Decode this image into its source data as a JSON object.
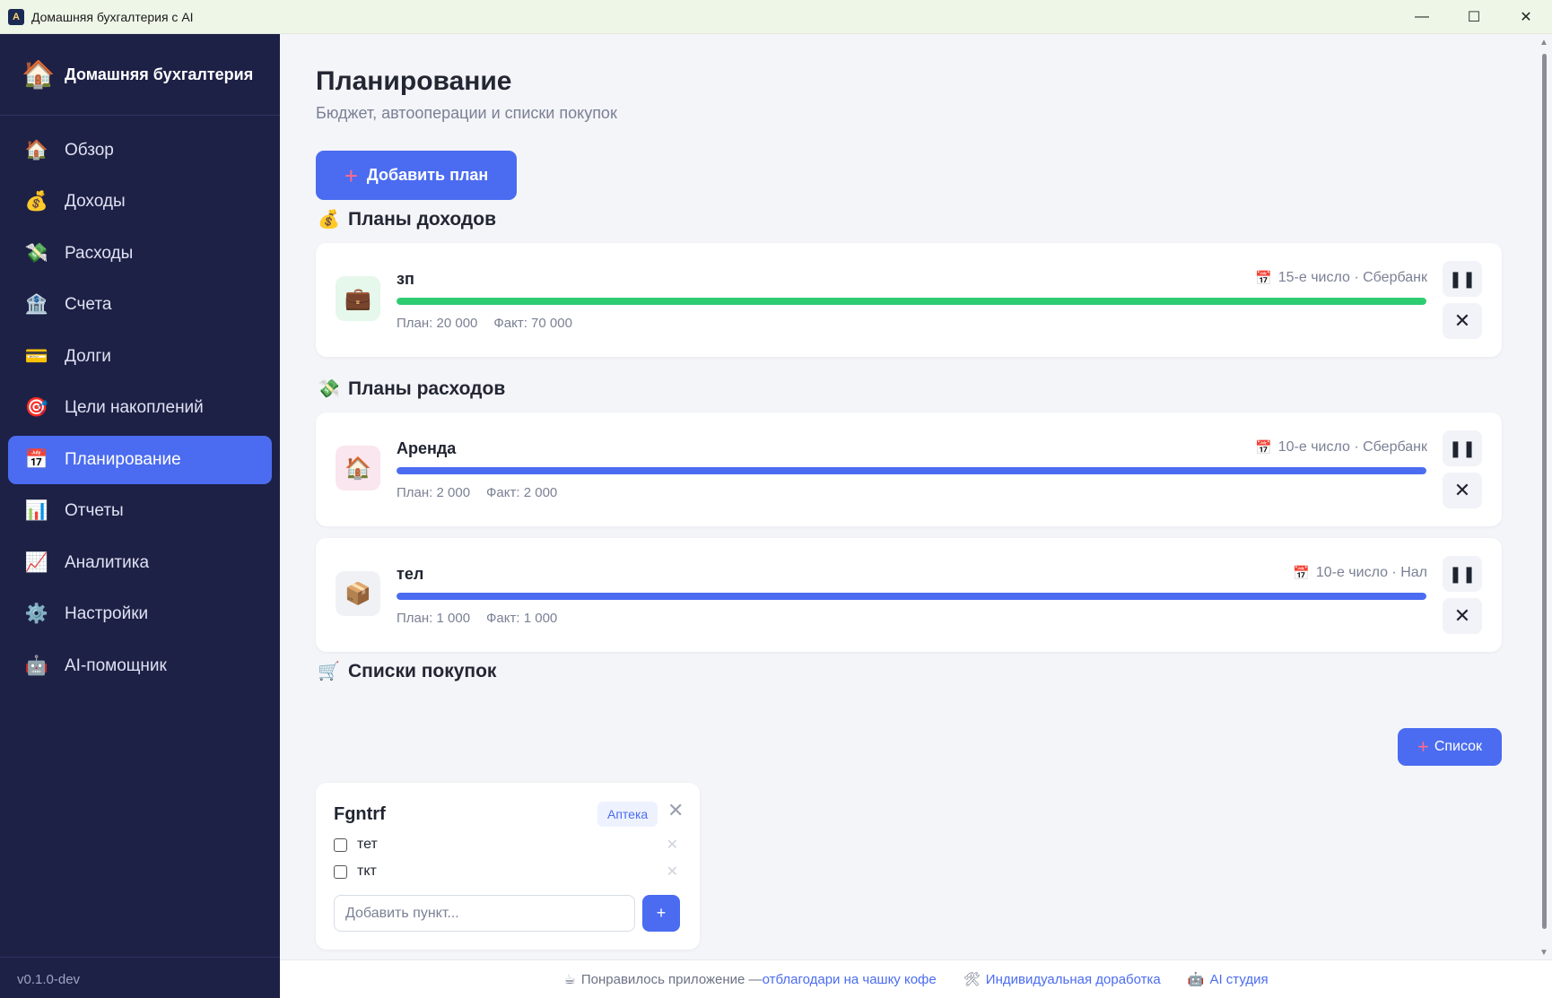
{
  "window": {
    "title": "Домашняя бухгалтерия с AI",
    "minimize": "—",
    "maximize": "☐",
    "close": "✕"
  },
  "sidebar": {
    "brand_icon": "🏠",
    "brand_name": "Домашняя бухгалтерия",
    "items": [
      {
        "icon": "🏠",
        "icon_name": "home-icon",
        "label": "Обзор"
      },
      {
        "icon": "💰",
        "icon_name": "money-bag-icon",
        "label": "Доходы"
      },
      {
        "icon": "💸",
        "icon_name": "money-wings-icon",
        "label": "Расходы"
      },
      {
        "icon": "🏦",
        "icon_name": "bank-icon",
        "label": "Счета"
      },
      {
        "icon": "💳",
        "icon_name": "credit-card-icon",
        "label": "Долги"
      },
      {
        "icon": "🎯",
        "icon_name": "target-icon",
        "label": "Цели накоплений"
      },
      {
        "icon": "📅",
        "icon_name": "calendar-icon",
        "label": "Планирование",
        "active": true
      },
      {
        "icon": "📊",
        "icon_name": "bar-chart-icon",
        "label": "Отчеты"
      },
      {
        "icon": "📈",
        "icon_name": "trend-chart-icon",
        "label": "Аналитика"
      },
      {
        "icon": "⚙️",
        "icon_name": "gear-icon",
        "label": "Настройки"
      },
      {
        "icon": "🤖",
        "icon_name": "robot-icon",
        "label": "AI-помощник"
      }
    ],
    "version": "v0.1.0-dev"
  },
  "main": {
    "title": "Планирование",
    "subtitle": "Бюджет, автооперации и списки покупок",
    "add_plan_label": "Добавить план",
    "income_section": {
      "icon": "💰",
      "title": "Планы доходов"
    },
    "expense_section": {
      "icon": "💸",
      "title": "Планы расходов"
    },
    "shopping_section": {
      "icon": "🛒",
      "title": "Списки покупок",
      "add_list_label": "Список"
    }
  },
  "income_plans": [
    {
      "icon": "💼",
      "name": "зп",
      "meta": "15-е число · Сбербанк",
      "plan": "План: 20 000",
      "fact": "Факт: 70 000",
      "progress": 1.0,
      "color": "#2ecc71",
      "avatar_bg": "#e6f7ec"
    }
  ],
  "expense_plans": [
    {
      "icon": "🏠",
      "name": "Аренда",
      "meta": "10-е число · Сбербанк",
      "plan": "План: 2 000",
      "fact": "Факт: 2 000",
      "progress": 1.0,
      "color": "#4b6cf0",
      "avatar_bg": "#f9e6ee"
    },
    {
      "icon": "📦",
      "name": "тел",
      "meta": "10-е число · Нал",
      "plan": "План: 1 000",
      "fact": "Факт: 1 000",
      "progress": 1.0,
      "color": "#4b6cf0",
      "avatar_bg": "#f0f1f4"
    }
  ],
  "shopping_list": {
    "title": "Fgntrf",
    "tag": "Аптека",
    "items": [
      "тет",
      "ткт"
    ],
    "input_placeholder": "Добавить пункт...",
    "add_button": "+"
  },
  "footer": {
    "coffee_text": "Понравилось приложение — ",
    "coffee_link": "отблагодари на чашку кофе",
    "custom_link": "Индивидуальная доработка",
    "studio_link": "AI студия"
  },
  "colors": {
    "accent": "#4b6cf0",
    "sidebar_bg": "#1e2146",
    "income_bar": "#2ecc71"
  }
}
